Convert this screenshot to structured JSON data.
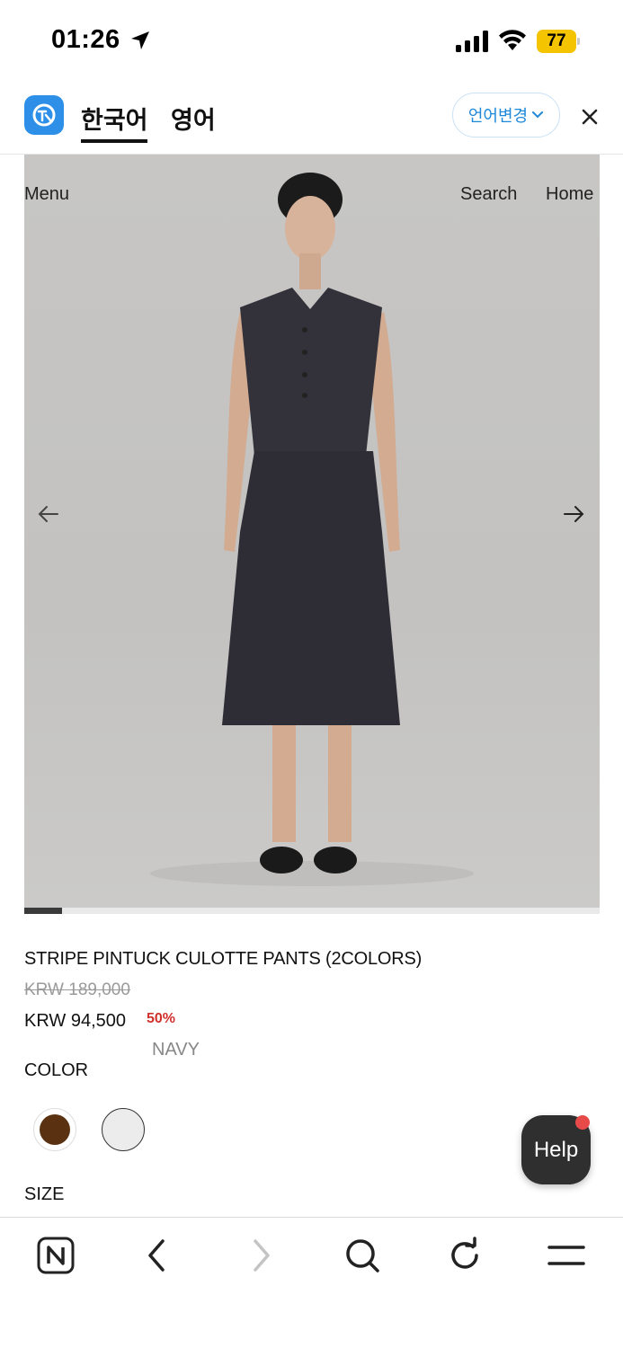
{
  "status_bar": {
    "time": "01:26",
    "battery": "77",
    "icons": [
      "location-arrow-icon",
      "signal-icon",
      "wifi-icon",
      "battery-icon"
    ]
  },
  "translate_bar": {
    "logo": "translate-app-logo",
    "tabs": [
      {
        "label": "한국어",
        "active": true
      },
      {
        "label": "영어",
        "active": false
      }
    ],
    "change_language_label": "언어변경",
    "close_icon": "close-icon"
  },
  "product_image": {
    "nav": {
      "menu": "Menu",
      "search": "Search",
      "home": "Home"
    },
    "prev_icon": "arrow-left-icon",
    "next_icon": "arrow-right-icon",
    "slide_progress": 0.066
  },
  "product": {
    "title": "STRIPE PINTUCK CULOTTE PANTS (2COLORS)",
    "original_price": "KRW 189,000",
    "price": "KRW 94,500",
    "discount": "50%",
    "selected_color": "NAVY",
    "color_label": "COLOR",
    "swatches": [
      {
        "name": "brown",
        "color": "#5a3212"
      },
      {
        "name": "white",
        "color": "#ececec"
      }
    ],
    "size_label": "SIZE"
  },
  "help": {
    "label": "Help",
    "notification_color": "#e84a4a"
  },
  "browser_toolbar": {
    "items": [
      "naver-home-icon",
      "back-icon",
      "forward-icon",
      "search-icon",
      "refresh-icon",
      "menu-icon"
    ]
  },
  "colors": {
    "accent_blue": "#1e88d9",
    "discount_red": "#d0312d",
    "battery_yellow": "#f5c400"
  }
}
